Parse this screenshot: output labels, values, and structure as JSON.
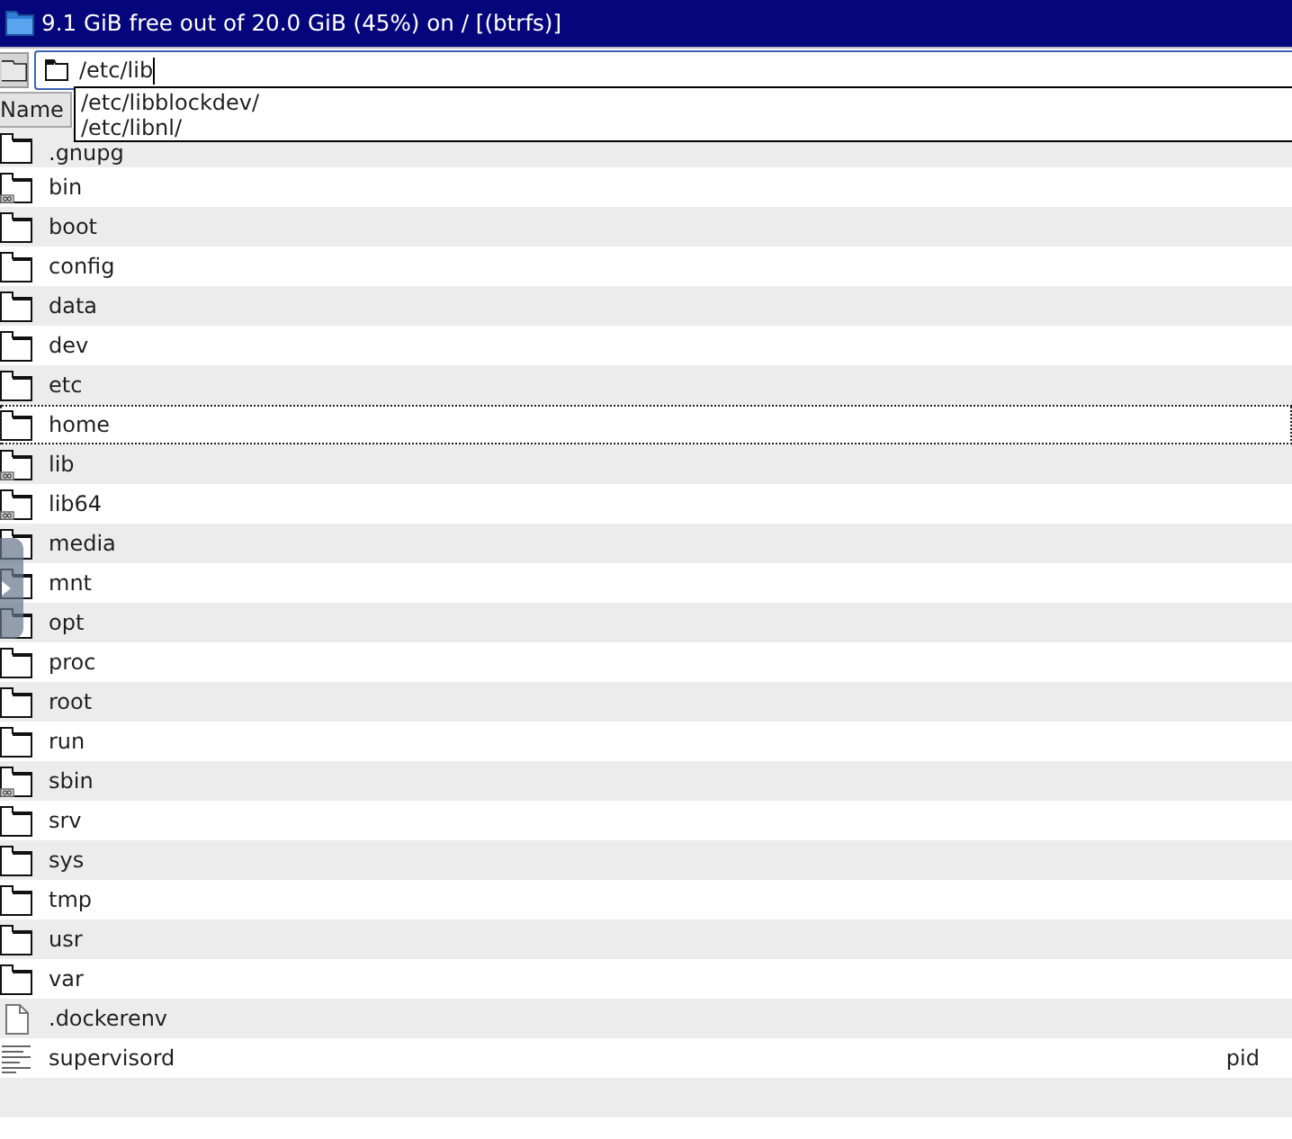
{
  "title_bar": {
    "title": "9.1 GiB free out of 20.0 GiB (45%) on / [(btrfs)]"
  },
  "location_bar": {
    "value": "/etc/lib",
    "completions": [
      "/etc/libblockdev/",
      "/etc/libnl/"
    ]
  },
  "columns": [
    "Name"
  ],
  "files": [
    {
      "name": ".gnupg",
      "kind": "folder",
      "focused": false
    },
    {
      "name": "bin",
      "kind": "linked-folder",
      "focused": false
    },
    {
      "name": "boot",
      "kind": "folder",
      "focused": false
    },
    {
      "name": "config",
      "kind": "folder",
      "focused": false
    },
    {
      "name": "data",
      "kind": "folder",
      "focused": false
    },
    {
      "name": "dev",
      "kind": "folder",
      "focused": false
    },
    {
      "name": "etc",
      "kind": "folder",
      "focused": false
    },
    {
      "name": "home",
      "kind": "folder",
      "focused": true
    },
    {
      "name": "lib",
      "kind": "linked-folder",
      "focused": false
    },
    {
      "name": "lib64",
      "kind": "linked-folder",
      "focused": false
    },
    {
      "name": "media",
      "kind": "folder",
      "focused": false
    },
    {
      "name": "mnt",
      "kind": "folder",
      "focused": false
    },
    {
      "name": "opt",
      "kind": "folder",
      "focused": false
    },
    {
      "name": "proc",
      "kind": "folder",
      "focused": false
    },
    {
      "name": "root",
      "kind": "folder",
      "focused": false
    },
    {
      "name": "run",
      "kind": "folder",
      "focused": false
    },
    {
      "name": "sbin",
      "kind": "linked-folder",
      "focused": false
    },
    {
      "name": "srv",
      "kind": "folder",
      "focused": false
    },
    {
      "name": "sys",
      "kind": "folder",
      "focused": false
    },
    {
      "name": "tmp",
      "kind": "folder",
      "focused": false
    },
    {
      "name": "usr",
      "kind": "folder",
      "focused": false
    },
    {
      "name": "var",
      "kind": "folder",
      "focused": false
    },
    {
      "name": ".dockerenv",
      "kind": "file",
      "focused": false
    },
    {
      "name": "supervisord",
      "kind": "text-file",
      "focused": false,
      "column_2": "pid"
    }
  ]
}
